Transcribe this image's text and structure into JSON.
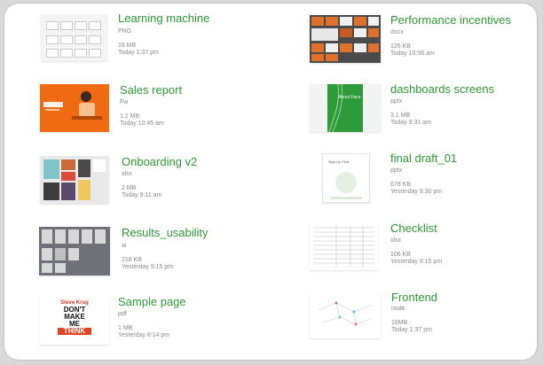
{
  "files": [
    {
      "title": "Learning machine",
      "type": "PNG",
      "size": "16 MB",
      "date": "Today 1:37 pm"
    },
    {
      "title": "Sales report",
      "type": "Fw",
      "size": "1.2 MB",
      "date": "Today 10:45 am"
    },
    {
      "title": "Onboarding v2",
      "type": "xlsx",
      "size": "2 MB",
      "date": "Today 9:11 am"
    },
    {
      "title": "Results_usability",
      "type": "ai",
      "size": "216 KB",
      "date": "Yesterday 9:15 pm"
    },
    {
      "title": "Sample page",
      "type": "pdf",
      "size": "1 MB",
      "date": "Yesterday 8:14 pm"
    },
    {
      "title": "Performance incentives",
      "type": "docx",
      "size": "126 KB",
      "date": "Today 10:56 am"
    },
    {
      "title": "dashboards screens",
      "type": "pptx",
      "size": "3.1 MB",
      "date": "Today 9:31 am"
    },
    {
      "title": "final draft_01",
      "type": "pptx",
      "size": "678 KB",
      "date": "Yesterday 9.30 pm"
    },
    {
      "title": "Checklist",
      "type": "xlsx",
      "size": "106 KB",
      "date": "Yesterday 8:15 pm"
    },
    {
      "title": "Frontend",
      "type": "node",
      "size": "16MB",
      "date": "Today 1:37 pm"
    }
  ],
  "thumb_text": {
    "book_author": "Steve Krug",
    "book_line1": "DON'T",
    "book_line2": "MAKE",
    "book_line3": "ME",
    "book_line4": "THINK",
    "dash_heading": "About Face",
    "final_heading": "Sign Up Flow"
  },
  "colors": {
    "title": "#2e9a34",
    "meta": "#8a8a8a",
    "card": "#ffffff",
    "background": "#d9d9d9"
  }
}
